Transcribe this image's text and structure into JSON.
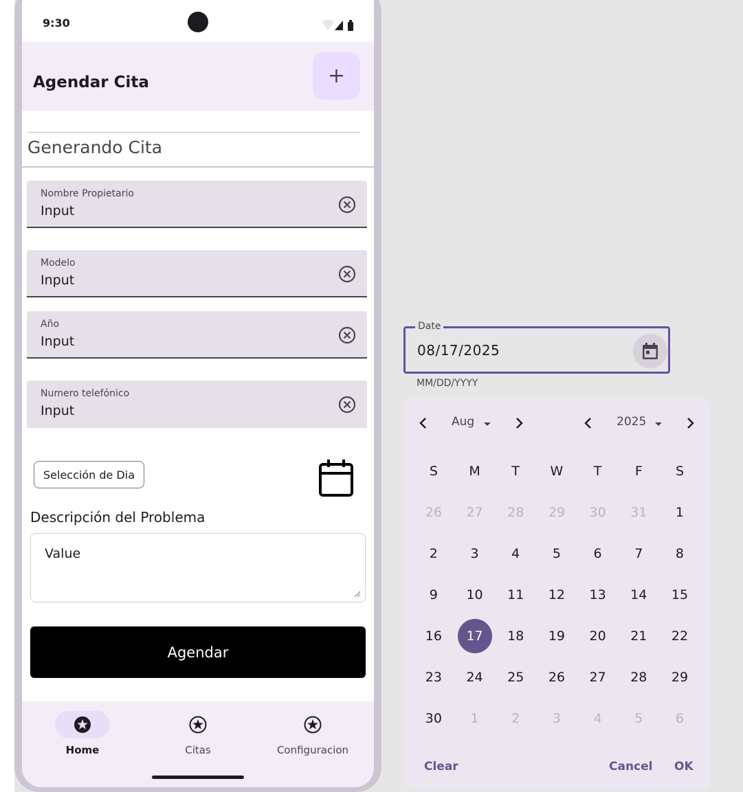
{
  "status": {
    "time": "9:30"
  },
  "app_bar": {
    "title": "Agendar Cita",
    "fab_label": "+"
  },
  "section_title": "Generando Cita",
  "fields": [
    {
      "label": "Nombre Propietario",
      "value": "Input"
    },
    {
      "label": "Modelo",
      "value": "Input"
    },
    {
      "label": "Año",
      "value": "Input"
    },
    {
      "label": "Numero telefónico",
      "value": "Input"
    }
  ],
  "day_chip": "Selección de Dia",
  "description": {
    "label": "Descripción del Problema",
    "value": "Value"
  },
  "submit_label": "Agendar",
  "nav": [
    {
      "label": "Home",
      "icon": "star-icon",
      "active": true
    },
    {
      "label": "Citas",
      "icon": "star-icon",
      "active": false
    },
    {
      "label": "Configuracion",
      "icon": "star-icon",
      "active": false
    }
  ],
  "date_field": {
    "label": "Date",
    "value": "08/17/2025",
    "helper": "MM/DD/YYYY"
  },
  "picker": {
    "month": "Aug",
    "year": "2025",
    "weekdays": [
      "S",
      "M",
      "T",
      "W",
      "T",
      "F",
      "S"
    ],
    "weeks": [
      [
        "26",
        "27",
        "28",
        "29",
        "30",
        "31",
        "1"
      ],
      [
        "2",
        "3",
        "4",
        "5",
        "6",
        "7",
        "8"
      ],
      [
        "9",
        "10",
        "11",
        "12",
        "13",
        "14",
        "15"
      ],
      [
        "16",
        "17",
        "18",
        "19",
        "20",
        "21",
        "22"
      ],
      [
        "23",
        "24",
        "25",
        "26",
        "27",
        "28",
        "29"
      ],
      [
        "30",
        "1",
        "2",
        "3",
        "4",
        "5",
        "6"
      ]
    ],
    "selected_day": "17",
    "clear_label": "Clear",
    "cancel_label": "Cancel",
    "ok_label": "OK"
  },
  "colors": {
    "accent": "#65558f",
    "field_bg": "#e6e0e9",
    "app_bar_bg": "#f3edf7"
  }
}
